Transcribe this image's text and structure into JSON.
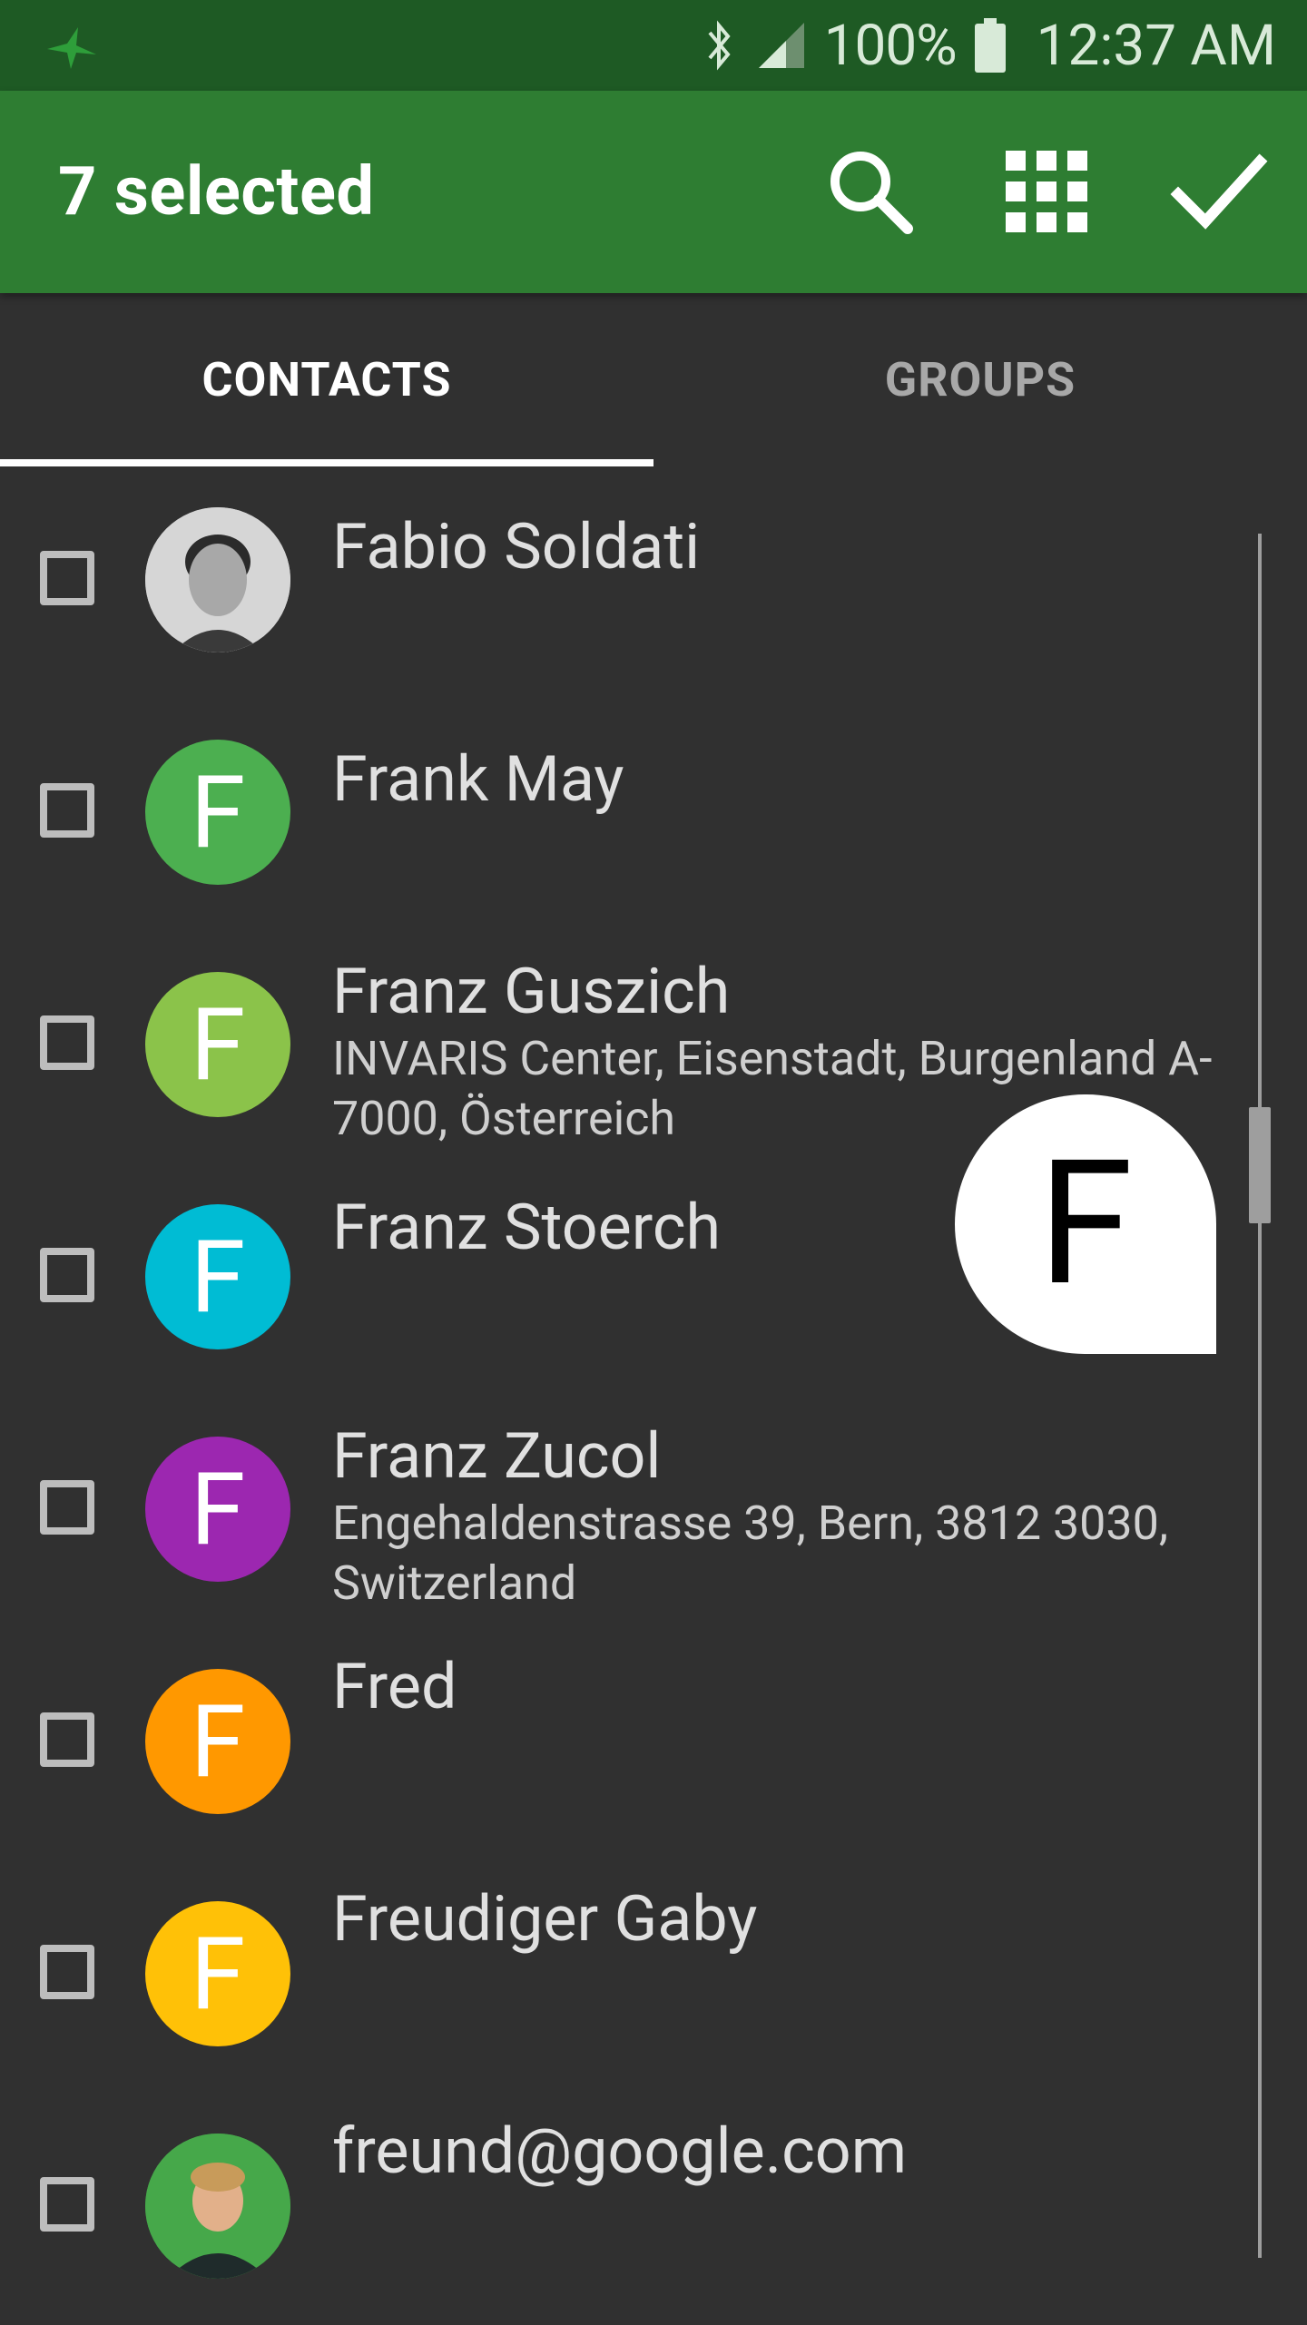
{
  "status_bar": {
    "battery": "100%",
    "time": "12:37 AM"
  },
  "toolbar": {
    "title": "7 selected",
    "actions": [
      "search-icon",
      "dialpad-icon",
      "check-icon"
    ]
  },
  "tabs": [
    {
      "label": "CONTACTS",
      "active": true
    },
    {
      "label": "GROUPS",
      "active": false
    }
  ],
  "index_bubble": "F",
  "contacts": [
    {
      "name": "Fabio Soldati",
      "subtitle": "",
      "avatar": "photo",
      "initial": "",
      "color": "#9e9e9e"
    },
    {
      "name": "Frank May",
      "subtitle": "",
      "avatar": "initial",
      "initial": "F",
      "color": "#4caf50"
    },
    {
      "name": "Franz Guszich",
      "subtitle": "INVARIS Center, Eisenstadt, Burgenland A-7000, Österreich",
      "avatar": "initial",
      "initial": "F",
      "color": "#8bc34a"
    },
    {
      "name": "Franz Stoerch",
      "subtitle": "",
      "avatar": "initial",
      "initial": "F",
      "color": "#00bcd4"
    },
    {
      "name": "Franz Zucol",
      "subtitle": "Engehaldenstrasse 39, Bern, 3812 3030, Switzerland",
      "avatar": "initial",
      "initial": "F",
      "color": "#9c27b0"
    },
    {
      "name": "Fred",
      "subtitle": "",
      "avatar": "initial",
      "initial": "F",
      "color": "#ff9800"
    },
    {
      "name": "Freudiger Gaby",
      "subtitle": "",
      "avatar": "initial",
      "initial": "F",
      "color": "#ffc107"
    },
    {
      "name": "freund@google.com",
      "subtitle": "",
      "avatar": "photo",
      "initial": "",
      "color": "#43a047"
    }
  ]
}
